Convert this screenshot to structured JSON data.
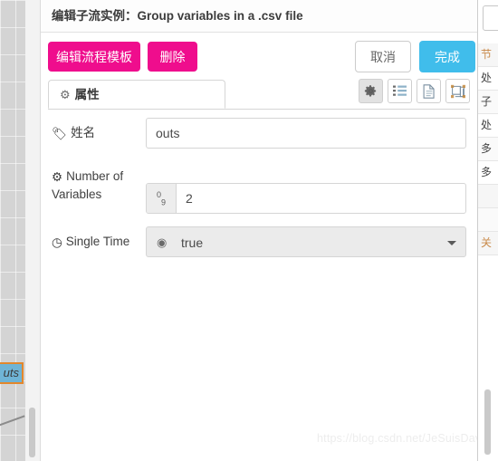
{
  "canvas": {
    "node_label": "uts",
    "node_fill": "#6fb4d6",
    "node_border": "#e3872c"
  },
  "modal": {
    "title": "编辑子流实例：Group variables in a .csv file",
    "actions": {
      "edit_template_label": "编辑流程模板",
      "delete_label": "删除",
      "cancel_label": "取消",
      "done_label": "完成",
      "primary_pink": "#ef0d8d",
      "primary_blue": "#40bdeb"
    },
    "tabs": [
      {
        "label": "属性",
        "icon": "gear-icon",
        "active": true
      }
    ],
    "icon_buttons": [
      {
        "name": "properties-view-icon",
        "active": true
      },
      {
        "name": "list-view-icon",
        "active": false
      },
      {
        "name": "document-view-icon",
        "active": false
      },
      {
        "name": "diagram-view-icon",
        "active": false
      }
    ],
    "form": {
      "fields": [
        {
          "label": "姓名",
          "icon": "tag-icon",
          "type": "text",
          "value": "outs",
          "placeholder": ""
        },
        {
          "label": "Number of Variables",
          "icon": "cogs-icon",
          "type": "number",
          "addon": "0/9",
          "addon_sup": "0",
          "addon_sub": "9",
          "value": "2",
          "placeholder": ""
        },
        {
          "label": "Single Time",
          "icon": "clock-icon",
          "type": "select",
          "value": "true",
          "icon_inner": "toggle-icon",
          "options": [
            "true",
            "false"
          ]
        }
      ]
    }
  },
  "right_panel": {
    "rows": [
      "节",
      "处",
      "子",
      "处",
      "多",
      "多",
      "",
      "",
      "关"
    ]
  },
  "watermark": {
    "text": "https://blog.csdn.net/JeSuisDavid"
  }
}
